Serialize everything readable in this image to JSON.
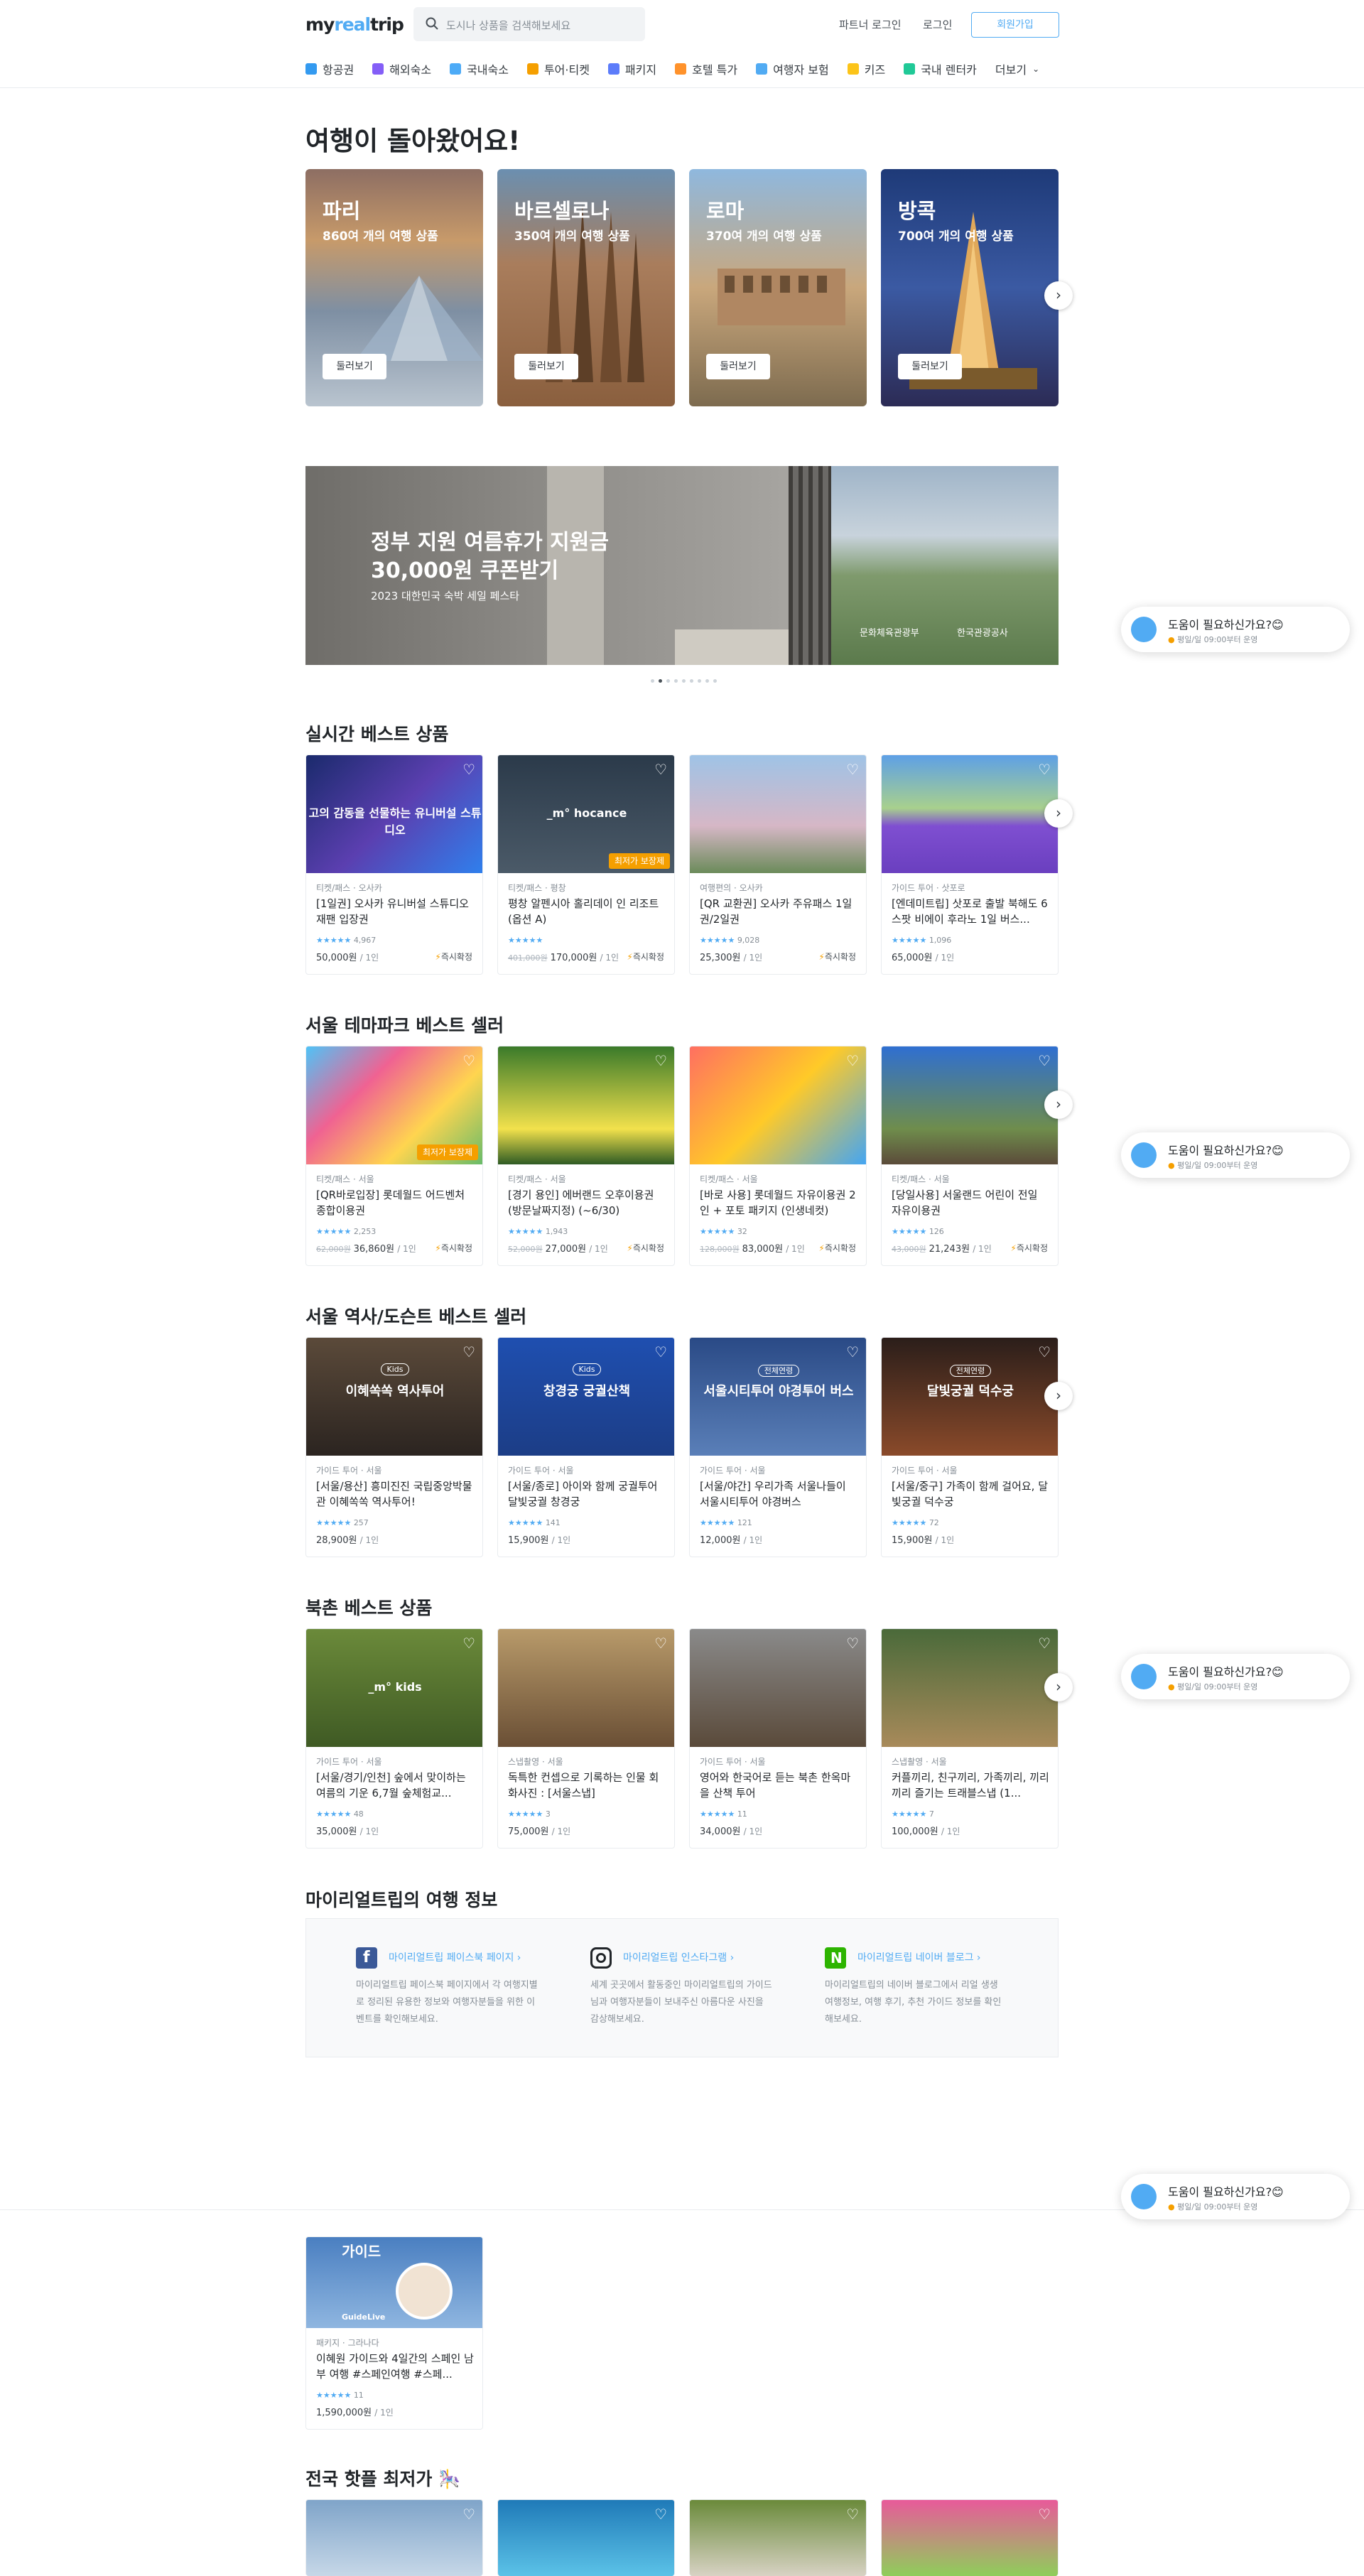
{
  "header": {
    "logo": {
      "part1": "my",
      "part2": "real",
      "part3": "trip"
    },
    "search_placeholder": "도시나 상품을 검색해보세요",
    "partner_login": "파트너 로그인",
    "login": "로그인",
    "signup": "회원가입",
    "nav": [
      {
        "label": "항공권",
        "icon": "plane-icon",
        "color": "#339af0"
      },
      {
        "label": "해외숙소",
        "icon": "hotel-icon",
        "color": "#845ef7"
      },
      {
        "label": "국내숙소",
        "icon": "building-icon",
        "color": "#4dabf7"
      },
      {
        "label": "투어·티켓",
        "icon": "ticket-icon",
        "color": "#f59f00"
      },
      {
        "label": "패키지",
        "icon": "suitcase-icon",
        "color": "#5c7cfa"
      },
      {
        "label": "호텔 특가",
        "icon": "hotel-sale-icon",
        "color": "#ff922b"
      },
      {
        "label": "여행자 보험",
        "icon": "insurance-icon",
        "color": "#51abf3"
      },
      {
        "label": "키즈",
        "icon": "kids-icon",
        "color": "#fcc419"
      },
      {
        "label": "국내 렌터카",
        "icon": "car-icon",
        "color": "#20c997"
      }
    ],
    "more": "더보기"
  },
  "welcome": {
    "title": "여행이 돌아왔어요!",
    "cities": [
      {
        "name": "파리",
        "count": "860여 개의 여행 상품",
        "button": "둘러보기"
      },
      {
        "name": "바르셀로나",
        "count": "350여 개의 여행 상품",
        "button": "둘러보기"
      },
      {
        "name": "로마",
        "count": "370여 개의 여행 상품",
        "button": "둘러보기"
      },
      {
        "name": "방콕",
        "count": "700여 개의 여행 상품",
        "button": "둘러보기"
      }
    ]
  },
  "banner": {
    "line1": "정부 지원 여름휴가 지원금",
    "line2": "30,000원 쿠폰받기",
    "line3": "2023 대한민국 숙박 세일 페스타",
    "org1": "문화체육관광부",
    "org2": "한국관광공사",
    "slides": 9,
    "active_slide": 2
  },
  "sections": [
    {
      "title": "실시간 베스트 상품",
      "cards": [
        {
          "cat": "티켓/패스 · 오사카",
          "title": "[1일권] 오사카 유니버설 스튜디오 재팬 입장권",
          "reviews": "4,967",
          "price": "50,000원",
          "unit": "/ 1인",
          "instant": "즉시확정",
          "image_text": "고의 감동을 선물하는 유니버설 스튜디오"
        },
        {
          "cat": "티켓/패스 · 평창",
          "title": "평창 알펜시아 홀리데이 인 리조트 (옵션 A)",
          "reviews": "",
          "old": "401,000원",
          "price": "170,000원",
          "unit": "/ 1인",
          "instant": "즉시확정",
          "tag": "최저가 보장제",
          "image_text": "_m° hocance"
        },
        {
          "cat": "여행편의 · 오사카",
          "title": "[QR 교환권] 오사카 주유패스 1일권/2일권",
          "reviews": "9,028",
          "price": "25,300원",
          "unit": "/ 1인",
          "instant": "즉시확정"
        },
        {
          "cat": "가이드 투어 · 삿포로",
          "title": "[엔데미트립] 삿포로 출발 북해도 6스팟 비에이 후라노 1일 버스...",
          "reviews": "1,096",
          "price": "65,000원",
          "unit": "/ 1인"
        }
      ]
    },
    {
      "title": "서울 테마파크 베스트 셀러",
      "cards": [
        {
          "cat": "티켓/패스 · 서울",
          "title": "[QR바로입장] 롯데월드 어드벤처 종합이용권",
          "reviews": "2,253",
          "old": "62,000원",
          "price": "36,860원",
          "unit": "/ 1인",
          "instant": "즉시확정",
          "tag": "최저가 보장제"
        },
        {
          "cat": "티켓/패스 · 서울",
          "title": "[경기 용인] 에버랜드 오후이용권 (방문날짜지정) (~6/30)",
          "reviews": "1,943",
          "old": "52,000원",
          "price": "27,000원",
          "unit": "/ 1인",
          "instant": "즉시확정"
        },
        {
          "cat": "티켓/패스 · 서울",
          "title": "[바로 사용] 롯데월드 자유이용권 2인 + 포토 패키지 (인생네컷)",
          "reviews": "32",
          "old": "128,000원",
          "price": "83,000원",
          "unit": "/ 1인",
          "instant": "즉시확정"
        },
        {
          "cat": "티켓/패스 · 서울",
          "title": "[당일사용] 서울랜드 어린이 전일 자유이용권",
          "reviews": "126",
          "old": "43,000원",
          "price": "21,243원",
          "unit": "/ 1인",
          "instant": "즉시확정"
        }
      ]
    },
    {
      "title": "서울 역사/도슨트 베스트 셀러",
      "cards": [
        {
          "cat": "가이드 투어 · 서울",
          "title": "[서울/용산] 흥미진진 국립중앙박물관 이혜쏙쏙 역사투어!",
          "reviews": "257",
          "price": "28,900원",
          "unit": "/ 1인",
          "badge": "Kids",
          "image_text": "이혜쏙쏙 역사투어"
        },
        {
          "cat": "가이드 투어 · 서울",
          "title": "[서울/종로] 아이와 함께 궁궐투어 달빛궁궐 창경궁",
          "reviews": "141",
          "price": "15,900원",
          "unit": "/ 1인",
          "badge": "Kids",
          "image_text": "창경궁 궁궐산책"
        },
        {
          "cat": "가이드 투어 · 서울",
          "title": "[서울/야간] 우리가족 서울나들이 서울시티투어 야경버스",
          "reviews": "121",
          "price": "12,000원",
          "unit": "/ 1인",
          "badge": "전체연령",
          "image_text": "서울시티투어 야경투어 버스"
        },
        {
          "cat": "가이드 투어 · 서울",
          "title": "[서울/중구] 가족이 함께 걸어요, 달빛궁궐 덕수궁",
          "reviews": "72",
          "price": "15,900원",
          "unit": "/ 1인",
          "badge": "전체연령",
          "image_text": "달빛궁궐 덕수궁"
        }
      ]
    },
    {
      "title": "북촌 베스트 상품",
      "cards": [
        {
          "cat": "가이드 투어 · 서울",
          "title": "[서울/경기/인천] 숲에서 맞이하는 여름의 기운 6,7월 숲체험교...",
          "reviews": "48",
          "price": "35,000원",
          "unit": "/ 1인",
          "image_text": "_m° kids"
        },
        {
          "cat": "스냅촬영 · 서울",
          "title": "독특한 컨셉으로 기록하는 인물 회화사진 : [서울스냅]",
          "reviews": "3",
          "price": "75,000원",
          "unit": "/ 1인"
        },
        {
          "cat": "가이드 투어 · 서울",
          "title": "영어와 한국어로 듣는 북촌 한옥마을 산책 투어",
          "reviews": "11",
          "price": "34,000원",
          "unit": "/ 1인"
        },
        {
          "cat": "스냅촬영 · 서울",
          "title": "커플끼리, 친구끼리, 가족끼리, 끼리끼리 즐기는 트래블스냅 (1...",
          "reviews": "7",
          "price": "100,000원",
          "unit": "/ 1인"
        }
      ]
    }
  ],
  "info": {
    "title": "마이리얼트립의 여행 정보",
    "cols": [
      {
        "icon": "facebook-icon",
        "link": "마이리얼트립 페이스북 페이지 ›",
        "desc": "마이리얼트립 페이스북 페이지에서 각 여행지별로 정리된 유용한 정보와 여행자분들을 위한 이벤트를 확인해보세요."
      },
      {
        "icon": "instagram-icon",
        "link": "마이리얼트립 인스타그램 ›",
        "desc": "세계 곳곳에서 활동중인 마이리얼트립의 가이드님과 여행자분들이 보내주신 아름다운 사진을 감상해보세요."
      },
      {
        "icon": "naver-blog-icon",
        "link": "마이리얼트립 네이버 블로그 ›",
        "desc": "마이리얼트립의 네이버 블로그에서 리얼 생생 여행정보, 여행 후기, 추천 가이드 정보를 확인해보세요."
      }
    ]
  },
  "help": {
    "question": "도움이 필요하신가요?😊",
    "sub": "평일/일 09:00부터 운영"
  },
  "guide_card": {
    "label": "가이드",
    "sublabel": "GuideLive",
    "cat": "패키지 · 그라나다",
    "title": "이혜원 가이드와 4일간의 스페인 남부 여행 #스페인여행 #스페...",
    "reviews": "11",
    "price": "1,590,000원",
    "unit": "/ 1인"
  },
  "bottom": {
    "title": "전국 핫플 최저가 🎠"
  }
}
